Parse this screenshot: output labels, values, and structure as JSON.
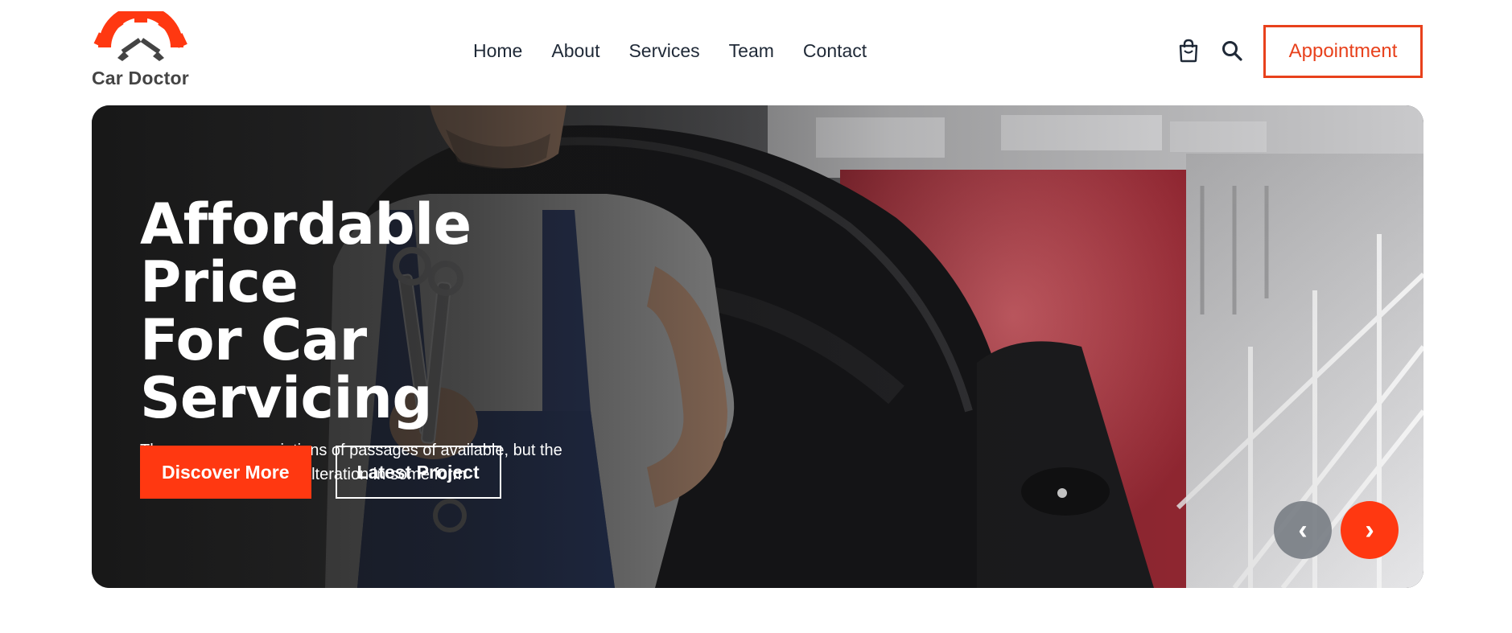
{
  "brand": {
    "name": "Car Doctor",
    "accent_color": "#ff3811"
  },
  "nav": {
    "items": [
      "Home",
      "About",
      "Services",
      "Team",
      "Contact"
    ]
  },
  "header": {
    "cart_icon": "shopping-bag-icon",
    "search_icon": "search-icon",
    "appointment_label": "Appointment"
  },
  "hero": {
    "title_lines": [
      "Affordable Price",
      "For Car",
      "Servicing"
    ],
    "description": "There are many variations of passages of available, but the majority have suffered alteration in some form",
    "primary_button": "Discover More",
    "secondary_button": "Latest Project",
    "prev_arrow": "‹",
    "next_arrow": "›"
  }
}
